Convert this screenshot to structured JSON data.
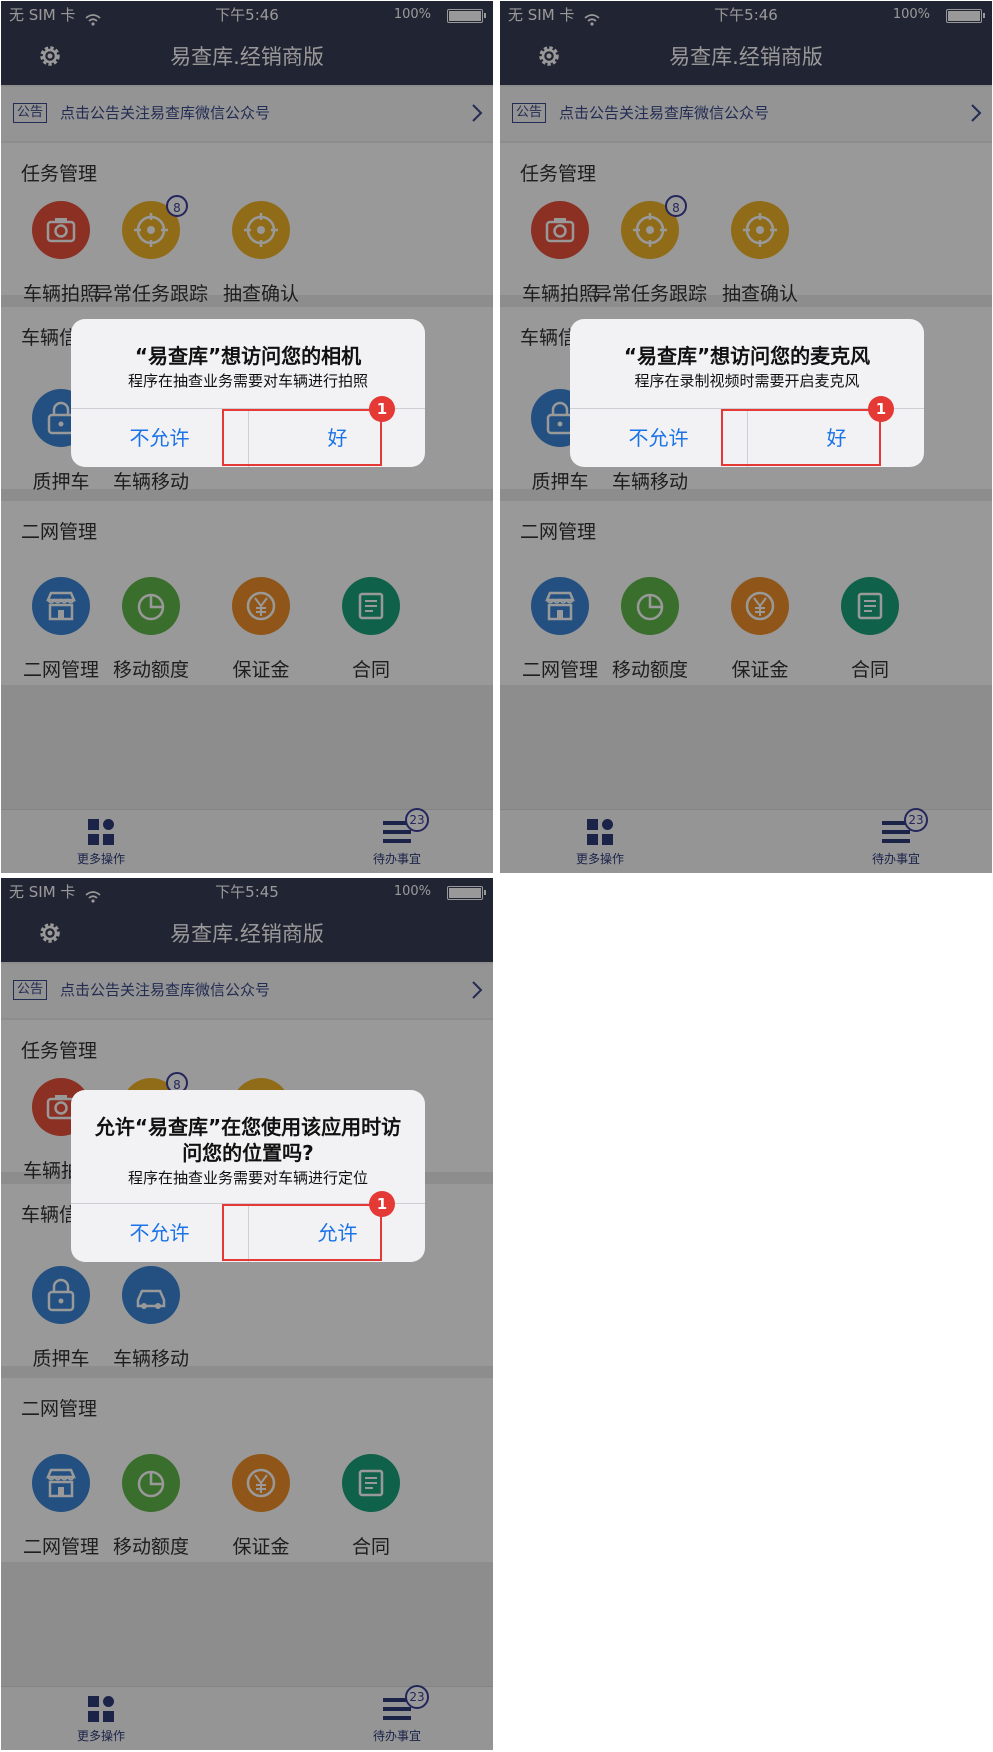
{
  "colors": {
    "nav_bg": "#383d54",
    "accent_blue": "#1a73e8",
    "highlight_red": "#e53935",
    "badge_blue": "#3b3f9a"
  },
  "app": {
    "title": "易查库.经销商版",
    "notice_tag": "公告",
    "notice_text": "点击公告关注易查库微信公众号",
    "sections": {
      "tasks": {
        "title": "任务管理",
        "items": [
          {
            "label": "车辆拍照",
            "icon": "camera-icon",
            "color": "#e8513a"
          },
          {
            "label": "异常任务跟踪",
            "icon": "target-icon",
            "color": "#f0b52a",
            "badge": "8"
          },
          {
            "label": "抽查确认",
            "icon": "target-icon",
            "color": "#f0b52a"
          }
        ]
      },
      "vehicle": {
        "title": "车辆信息",
        "items": [
          {
            "label": "质押车",
            "icon": "lock-icon",
            "color": "#3b86d6"
          },
          {
            "label": "车辆移动",
            "icon": "car-icon",
            "color": "#3b86d6"
          }
        ]
      },
      "network": {
        "title": "二网管理",
        "items": [
          {
            "label": "二网管理",
            "icon": "store-icon",
            "color": "#3b86d6"
          },
          {
            "label": "移动额度",
            "icon": "pie-icon",
            "color": "#62b84a"
          },
          {
            "label": "保证金",
            "icon": "yen-icon",
            "color": "#f0902a"
          },
          {
            "label": "合同",
            "icon": "document-icon",
            "color": "#1aa37a"
          }
        ]
      }
    },
    "tabs": {
      "more": "更多操作",
      "todo": "待办事宜",
      "todo_badge": "23"
    }
  },
  "panels": {
    "camera": {
      "status": {
        "carrier": "无 SIM 卡",
        "time": "下午5:46",
        "battery": "100%"
      },
      "dialog": {
        "title": "“易查库”想访问您的相机",
        "message": "程序在抽查业务需要对车辆进行拍照",
        "deny": "不允许",
        "allow": "好"
      },
      "step": "1"
    },
    "microphone": {
      "status": {
        "carrier": "无 SIM 卡",
        "time": "下午5:46",
        "battery": "100%"
      },
      "dialog": {
        "title": "“易查库”想访问您的麦克风",
        "message": "程序在录制视频时需要开启麦克风",
        "deny": "不允许",
        "allow": "好"
      },
      "step": "1"
    },
    "location": {
      "status": {
        "carrier": "无 SIM 卡",
        "time": "下午5:45",
        "battery": "100%"
      },
      "dialog": {
        "title": "允许“易查库”在您使用该应用时访问您的位置吗?",
        "message": "程序在抽查业务需要对车辆进行定位",
        "deny": "不允许",
        "allow": "允许"
      },
      "step": "1"
    }
  }
}
